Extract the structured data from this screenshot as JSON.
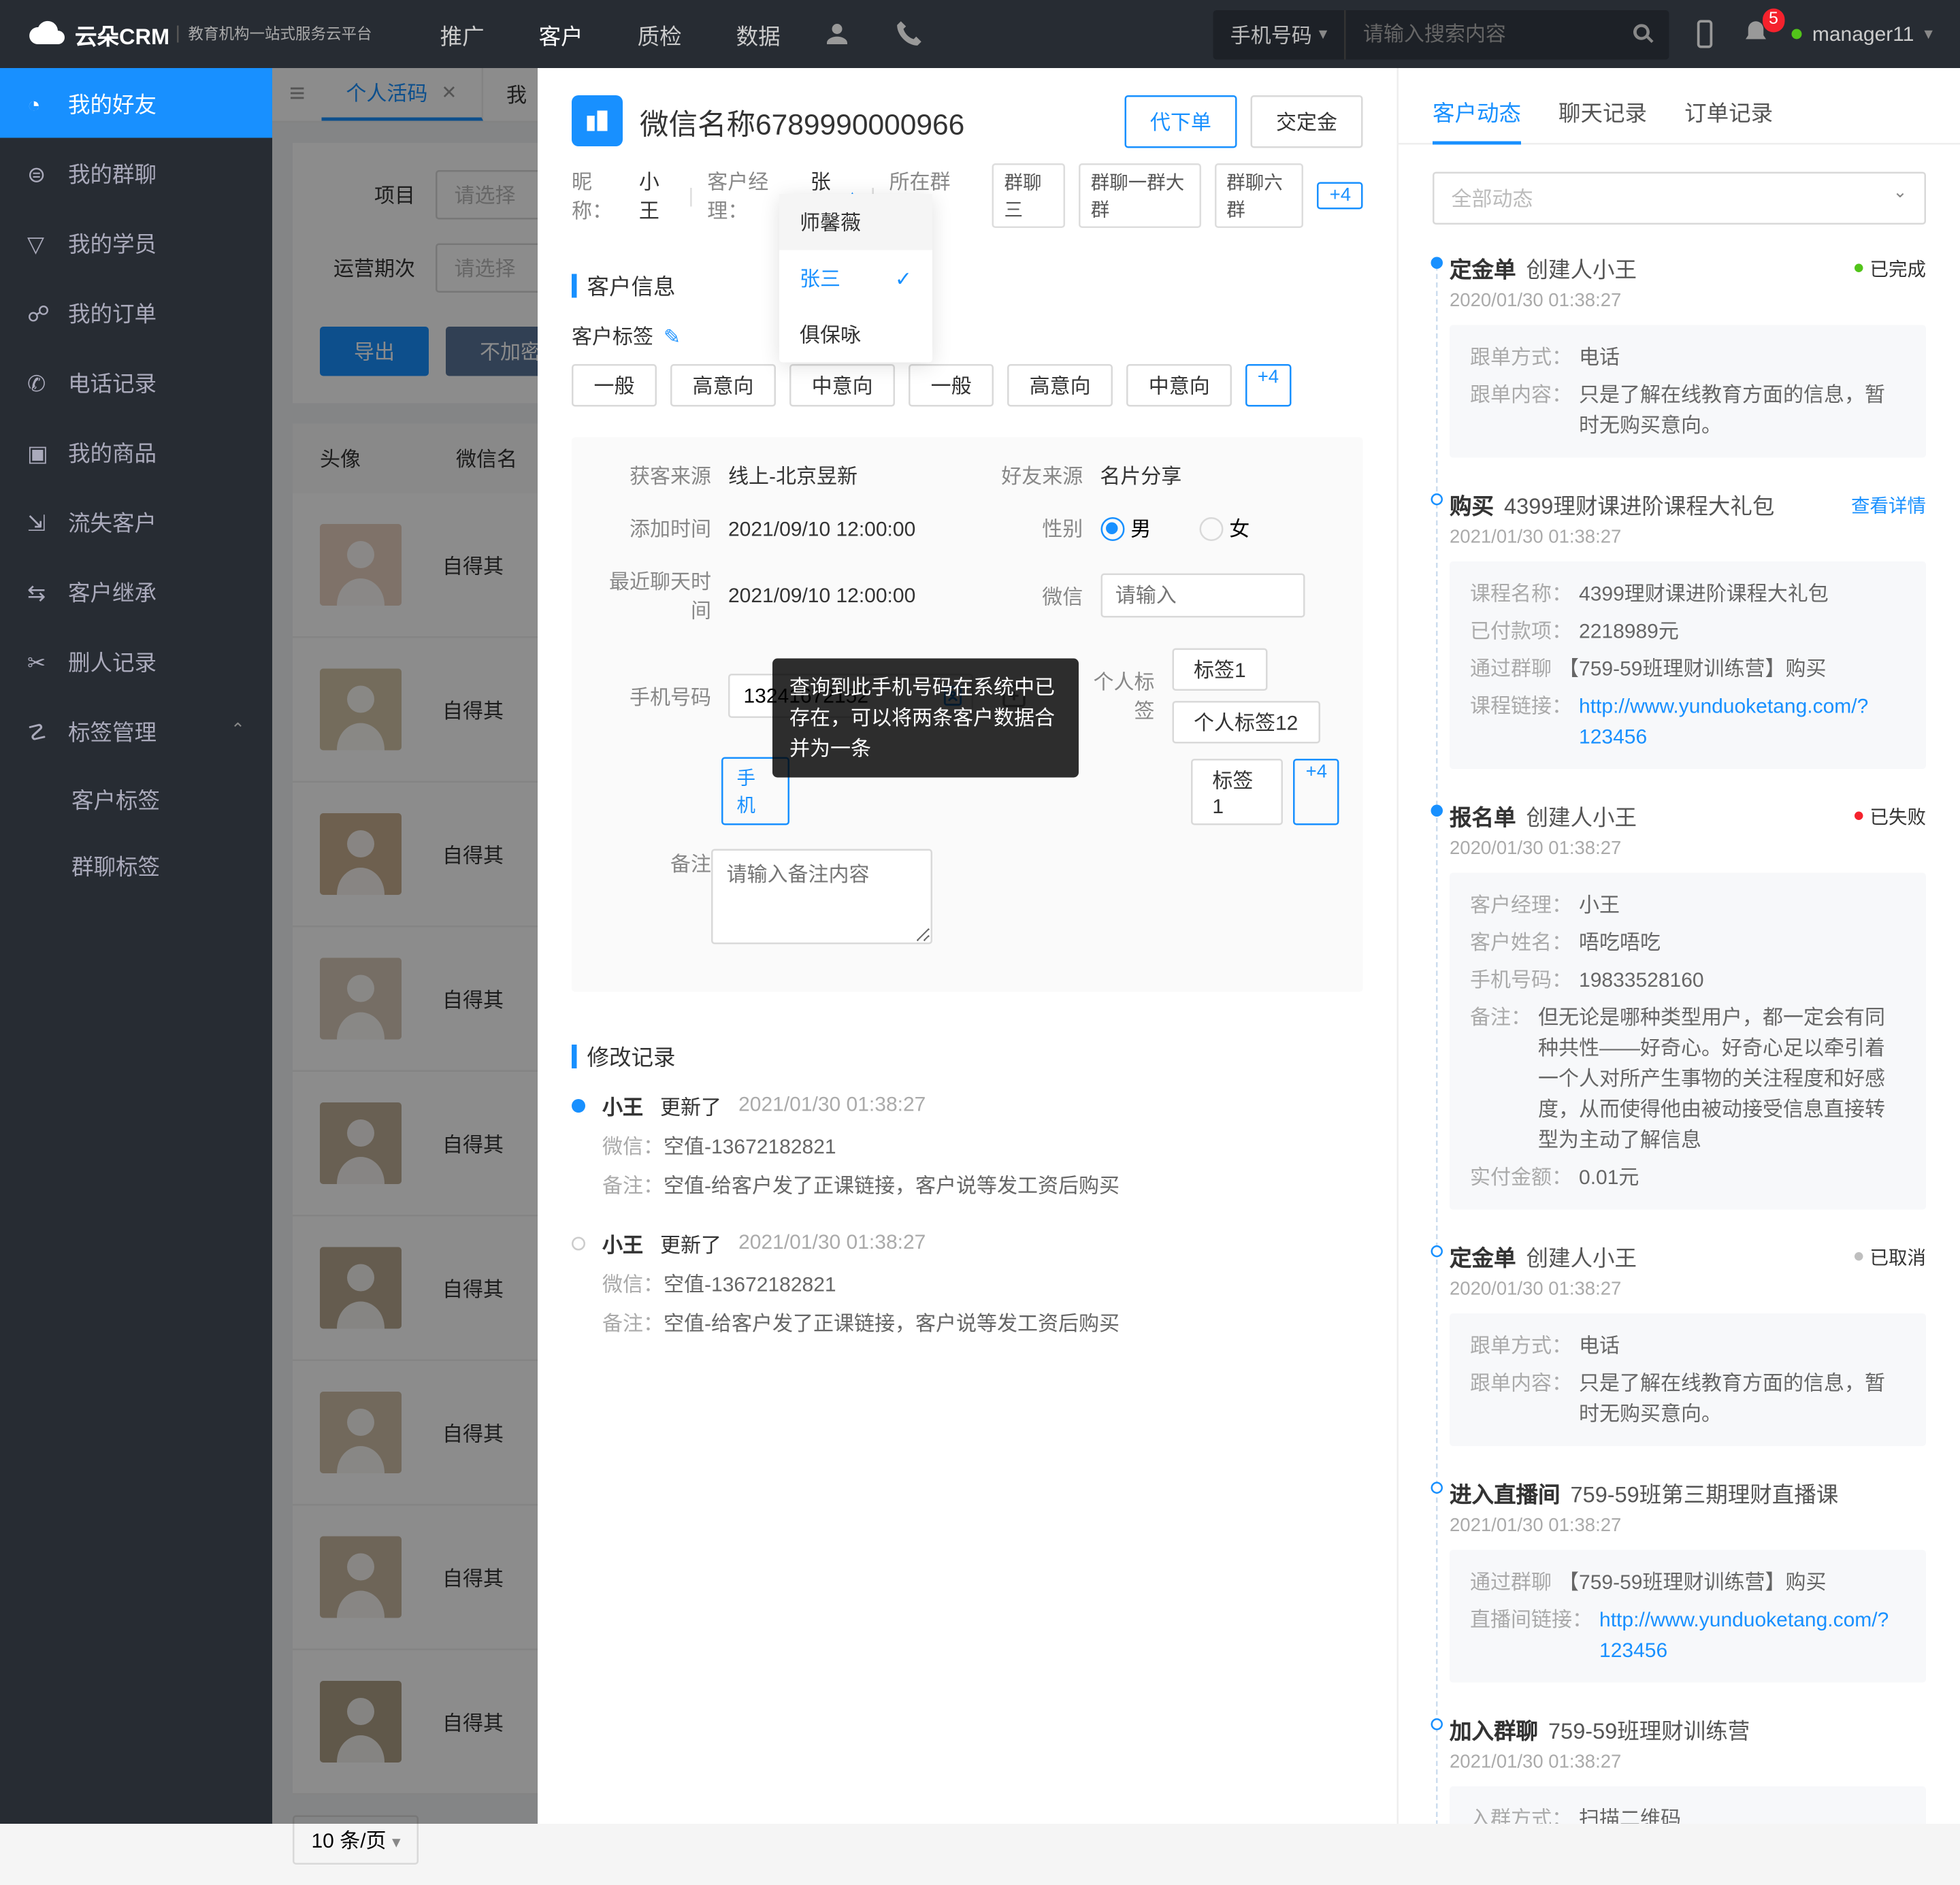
{
  "top": {
    "brand": "云朵CRM",
    "brand_sub": "教育机构一站式服务云平台",
    "nav": [
      "推广",
      "客户",
      "质检",
      "数据"
    ],
    "nav_active": 1,
    "search_type": "手机号码",
    "search_placeholder": "请输入搜索内容",
    "badge_count": "5",
    "user": "manager11"
  },
  "sidebar": {
    "items": [
      {
        "icon": "clock",
        "label": "我的好友"
      },
      {
        "icon": "chat",
        "label": "我的群聊"
      },
      {
        "icon": "filter",
        "label": "我的学员"
      },
      {
        "icon": "cart",
        "label": "我的订单"
      },
      {
        "icon": "phone",
        "label": "电话记录"
      },
      {
        "icon": "box",
        "label": "我的商品"
      },
      {
        "icon": "leave",
        "label": "流失客户"
      },
      {
        "icon": "inherit",
        "label": "客户继承"
      },
      {
        "icon": "del",
        "label": "删人记录"
      },
      {
        "icon": "tag",
        "label": "标签管理"
      }
    ],
    "subs": [
      "客户标签",
      "群聊标签"
    ]
  },
  "tabs": {
    "t1": "个人活码",
    "t2": "我"
  },
  "filters": {
    "f1_label": "项目",
    "f2_label": "运营期次",
    "placeholder": "请选择"
  },
  "actions": {
    "export": "导出",
    "unenc": "不加密导出"
  },
  "table": {
    "h_avatar": "头像",
    "h_name": "微信名",
    "cell_name": "自得其"
  },
  "pagination": {
    "size": "10 条/页"
  },
  "drawer": {
    "title": "微信名称6789990000966",
    "nick_label": "昵称：",
    "nick": "小王",
    "mgr_label": "客户经理：",
    "mgr": "张三",
    "group_label": "所在群聊：",
    "groups": [
      "群聊三",
      "群聊一群大群",
      "群聊六群"
    ],
    "groups_more": "+4",
    "btn_order": "代下单",
    "btn_deposit": "交定金",
    "dd": [
      "师馨薇",
      "张三",
      "俱保咏"
    ],
    "dd_selected": 1
  },
  "info": {
    "h": "客户信息",
    "tags_label": "客户标签",
    "tags": [
      "一般",
      "高意向",
      "中意向",
      "一般",
      "高意向",
      "中意向"
    ],
    "tags_more": "+4",
    "source_l": "获客来源",
    "source_v": "线上-北京昱新",
    "friend_l": "好友来源",
    "friend_v": "名片分享",
    "add_l": "添加时间",
    "add_v": "2021/09/10 12:00:00",
    "gender_l": "性别",
    "male": "男",
    "female": "女",
    "last_l": "最近聊天时间",
    "last_v": "2021/09/10 12:00:00",
    "wx_l": "微信",
    "wx_ph": "请输入",
    "phone_l": "手机号码",
    "phone_v": "13241672152",
    "phone_chip": "手机",
    "ptag_l": "个人标签",
    "ptags": [
      "标签1",
      "个人标签12",
      "标签1"
    ],
    "ptag_more": "+4",
    "remark_l": "备注",
    "remark_ph": "请输入备注内容",
    "tooltip": "查询到此手机号码在系统中已存在，可以将两条客户数据合并为一条"
  },
  "logs": {
    "h": "修改记录",
    "items": [
      {
        "who": "小王",
        "act": "更新了",
        "time": "2021/01/30   01:38:27",
        "lines": [
          [
            "微信：",
            "空值-13672182821"
          ],
          [
            "备注：",
            "空值-给客户发了正课链接，客户说等发工资后购买"
          ]
        ]
      },
      {
        "who": "小王",
        "act": "更新了",
        "time": "2021/01/30   01:38:27",
        "lines": [
          [
            "微信：",
            "空值-13672182821"
          ],
          [
            "备注：",
            "空值-给客户发了正课链接，客户说等发工资后购买"
          ]
        ]
      }
    ]
  },
  "right": {
    "tabs": [
      "客户动态",
      "聊天记录",
      "订单记录"
    ],
    "filter": "全部动态",
    "acts": [
      {
        "dot": "solid",
        "title": "定金单",
        "sub": "创建人小王",
        "time": "2020/01/30   01:38:27",
        "status": {
          "text": "已完成",
          "color": "#52c41a"
        },
        "card": [
          [
            "跟单方式：",
            "电话"
          ],
          [
            "跟单内容：",
            "只是了解在线教育方面的信息，暂时无购买意向。"
          ]
        ]
      },
      {
        "dot": "hollow",
        "title": "购买",
        "sub": "4399理财课进阶课程大礼包",
        "time": "2021/01/30   01:38:27",
        "detail": "查看详情",
        "card": [
          [
            "课程名称：",
            "4399理财课进阶课程大礼包"
          ],
          [
            "已付款项：",
            "2218989元"
          ],
          [
            "通过群聊",
            "【759-59班理财训练营】购买"
          ],
          [
            "课程链接：",
            "http://www.yunduoketang.com/?123456",
            "link"
          ]
        ]
      },
      {
        "dot": "solid",
        "title": "报名单",
        "sub": "创建人小王",
        "time": "2020/01/30   01:38:27",
        "status": {
          "text": "已失败",
          "color": "#f5222d"
        },
        "card": [
          [
            "客户经理：",
            "小王"
          ],
          [
            "客户姓名：",
            "唔吃唔吃"
          ],
          [
            "手机号码：",
            "19833528160"
          ],
          [
            "备注：",
            "但无论是哪种类型用户，都一定会有同种共性——好奇心。好奇心足以牵引着一个人对所产生事物的关注程度和好感度，从而使得他由被动接受信息直接转型为主动了解信息"
          ],
          [
            "实付金额：",
            "0.01元"
          ]
        ]
      },
      {
        "dot": "hollow",
        "title": "定金单",
        "sub": "创建人小王",
        "time": "2020/01/30   01:38:27",
        "status": {
          "text": "已取消",
          "color": "#bfbfbf"
        },
        "card": [
          [
            "跟单方式：",
            "电话"
          ],
          [
            "跟单内容：",
            "只是了解在线教育方面的信息，暂时无购买意向。"
          ]
        ]
      },
      {
        "dot": "hollow",
        "title": "进入直播间",
        "sub": "759-59班第三期理财直播课",
        "time": "2021/01/30   01:38:27",
        "card": [
          [
            "通过群聊",
            "【759-59班理财训练营】购买"
          ],
          [
            "直播间链接：",
            "http://www.yunduoketang.com/?123456",
            "link"
          ]
        ]
      },
      {
        "dot": "hollow",
        "title": "加入群聊",
        "sub": "759-59班理财训练营",
        "time": "2021/01/30   01:38:27",
        "card": [
          [
            "入群方式：",
            "扫描二维码"
          ]
        ]
      }
    ]
  }
}
